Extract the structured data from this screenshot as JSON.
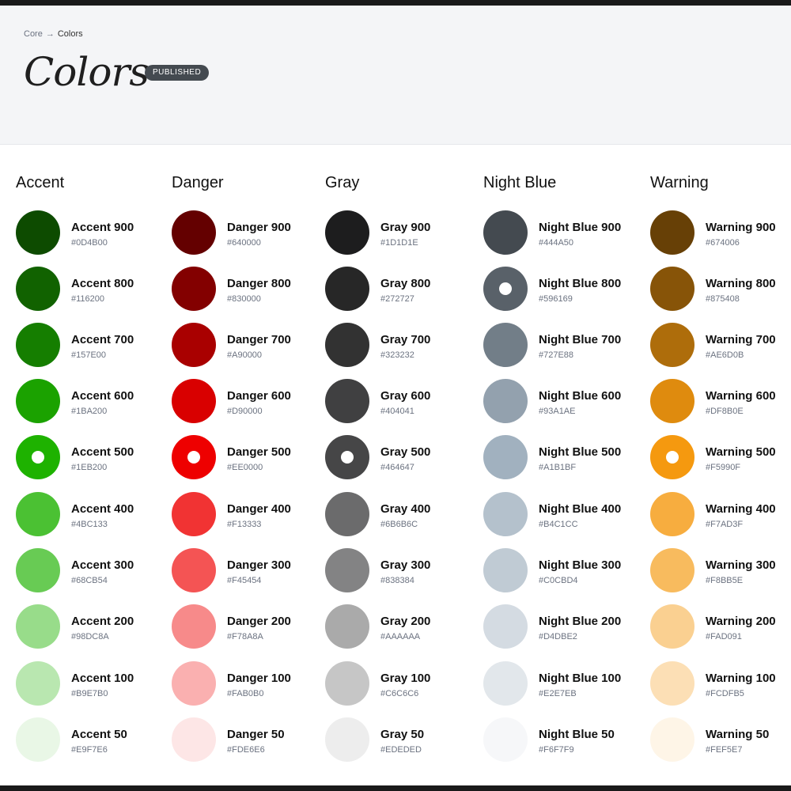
{
  "breadcrumb": {
    "parent": "Core",
    "separator": "→",
    "current": "Colors"
  },
  "title": "Colors",
  "status_badge": "PUBLISHED",
  "groups": [
    {
      "title": "Accent",
      "swatches": [
        {
          "name": "Accent 900",
          "hex": "#0D4B00",
          "color": "#0D4B00"
        },
        {
          "name": "Accent 800",
          "hex": "#116200",
          "color": "#116200"
        },
        {
          "name": "Accent 700",
          "hex": "#157E00",
          "color": "#157E00"
        },
        {
          "name": "Accent 600",
          "hex": "#1BA200",
          "color": "#1BA200"
        },
        {
          "name": "Accent 500",
          "hex": "#1EB200",
          "color": "#1EB200",
          "selected": true
        },
        {
          "name": "Accent 400",
          "hex": "#4BC133",
          "color": "#4BC133"
        },
        {
          "name": "Accent 300",
          "hex": "#68CB54",
          "color": "#68CB54"
        },
        {
          "name": "Accent 200",
          "hex": "#98DC8A",
          "color": "#98DC8A"
        },
        {
          "name": "Accent 100",
          "hex": "#B9E7B0",
          "color": "#B9E7B0"
        },
        {
          "name": "Accent 50",
          "hex": "#E9F7E6",
          "color": "#E9F7E6"
        }
      ]
    },
    {
      "title": "Danger",
      "swatches": [
        {
          "name": "Danger 900",
          "hex": "#640000",
          "color": "#640000"
        },
        {
          "name": "Danger 800",
          "hex": "#830000",
          "color": "#830000"
        },
        {
          "name": "Danger 700",
          "hex": "#A90000",
          "color": "#A90000"
        },
        {
          "name": "Danger 600",
          "hex": "#D90000",
          "color": "#D90000"
        },
        {
          "name": "Danger 500",
          "hex": "#EE0000",
          "color": "#EE0000",
          "selected": true
        },
        {
          "name": "Danger 400",
          "hex": "#F13333",
          "color": "#F13333"
        },
        {
          "name": "Danger 300",
          "hex": "#F45454",
          "color": "#F45454"
        },
        {
          "name": "Danger 200",
          "hex": "#F78A8A",
          "color": "#F78A8A"
        },
        {
          "name": "Danger 100",
          "hex": "#FAB0B0",
          "color": "#FAB0B0"
        },
        {
          "name": "Danger 50",
          "hex": "#FDE6E6",
          "color": "#FDE6E6"
        }
      ]
    },
    {
      "title": "Gray",
      "swatches": [
        {
          "name": "Gray 900",
          "hex": "#1D1D1E",
          "color": "#1D1D1E"
        },
        {
          "name": "Gray 800",
          "hex": "#272727",
          "color": "#272727"
        },
        {
          "name": "Gray 700",
          "hex": "#323232",
          "color": "#323232"
        },
        {
          "name": "Gray 600",
          "hex": "#404041",
          "color": "#404041"
        },
        {
          "name": "Gray 500",
          "hex": "#464647",
          "color": "#464647",
          "selected": true
        },
        {
          "name": "Gray 400",
          "hex": "#6B6B6C",
          "color": "#6B6B6C"
        },
        {
          "name": "Gray 300",
          "hex": "#838384",
          "color": "#838384"
        },
        {
          "name": "Gray 200",
          "hex": "#AAAAAA",
          "color": "#AAAAAA"
        },
        {
          "name": "Gray 100",
          "hex": "#C6C6C6",
          "color": "#C6C6C6"
        },
        {
          "name": "Gray 50",
          "hex": "#EDEDED",
          "color": "#EDEDED"
        }
      ]
    },
    {
      "title": "Night Blue",
      "swatches": [
        {
          "name": "Night Blue 900",
          "hex": "#444A50",
          "color": "#444A50"
        },
        {
          "name": "Night Blue 800",
          "hex": "#596169",
          "color": "#596169",
          "selected": true
        },
        {
          "name": "Night Blue 700",
          "hex": "#727E88",
          "color": "#727E88"
        },
        {
          "name": "Night Blue 600",
          "hex": "#93A1AE",
          "color": "#93A1AE"
        },
        {
          "name": "Night Blue 500",
          "hex": "#A1B1BF",
          "color": "#A1B1BF"
        },
        {
          "name": "Night Blue 400",
          "hex": "#B4C1CC",
          "color": "#B4C1CC"
        },
        {
          "name": "Night Blue 300",
          "hex": "#C0CBD4",
          "color": "#C0CBD4"
        },
        {
          "name": "Night Blue 200",
          "hex": "#D4DBE2",
          "color": "#D4DBE2"
        },
        {
          "name": "Night Blue 100",
          "hex": "#E2E7EB",
          "color": "#E2E7EB"
        },
        {
          "name": "Night Blue 50",
          "hex": "#F6F7F9",
          "color": "#F6F7F9"
        }
      ]
    },
    {
      "title": "Warning",
      "swatches": [
        {
          "name": "Warning 900",
          "hex": "#674006",
          "color": "#674006"
        },
        {
          "name": "Warning 800",
          "hex": "#875408",
          "color": "#875408"
        },
        {
          "name": "Warning 700",
          "hex": "#AE6D0B",
          "color": "#AE6D0B"
        },
        {
          "name": "Warning 600",
          "hex": "#DF8B0E",
          "color": "#DF8B0E"
        },
        {
          "name": "Warning 500",
          "hex": "#F5990F",
          "color": "#F5990F",
          "selected": true
        },
        {
          "name": "Warning 400",
          "hex": "#F7AD3F",
          "color": "#F7AD3F"
        },
        {
          "name": "Warning 300",
          "hex": "#F8BB5E",
          "color": "#F8BB5E"
        },
        {
          "name": "Warning 200",
          "hex": "#FAD091",
          "color": "#FAD091"
        },
        {
          "name": "Warning 100",
          "hex": "#FCDFB5",
          "color": "#FCDFB5"
        },
        {
          "name": "Warning 50",
          "hex": "#FEF5E7",
          "color": "#FEF5E7"
        }
      ]
    }
  ]
}
